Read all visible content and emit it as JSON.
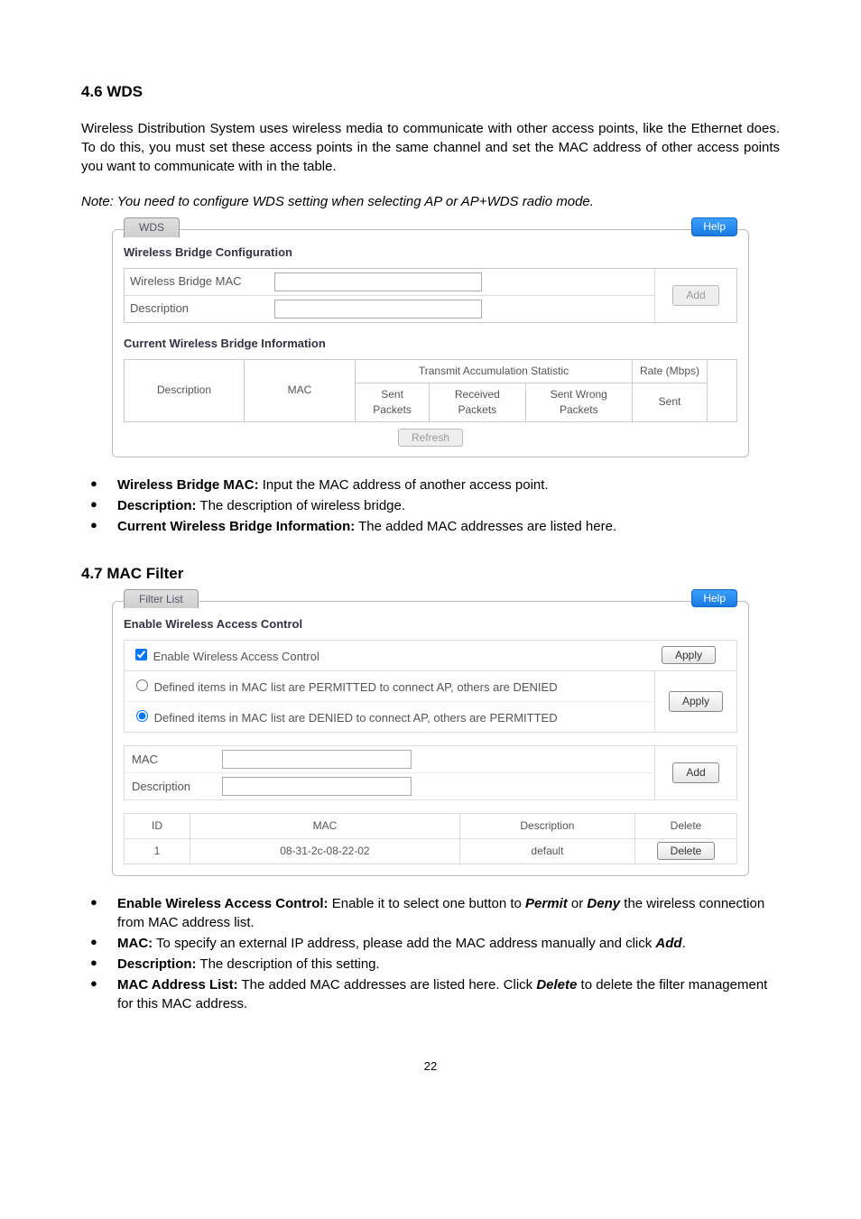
{
  "sec46": {
    "heading": "4.6 WDS",
    "para": "Wireless Distribution System uses wireless media to communicate with other access points, like the Ethernet does. To do this, you must set these access points in the same channel and set the MAC address of other access points you want to communicate with in the table.",
    "note": "Note: You need to configure WDS setting when selecting AP or AP+WDS radio mode."
  },
  "wds_panel": {
    "tab": "WDS",
    "help": "Help",
    "title1": "Wireless Bridge Configuration",
    "row_mac": "Wireless Bridge MAC",
    "row_desc": "Description",
    "add_btn": "Add",
    "title2": "Current Wireless Bridge Information",
    "col_desc": "Description",
    "col_mac": "MAC",
    "col_stat": "Transmit Accumulation Statistic",
    "col_rate": "Rate (Mbps)",
    "col_sent_pkts": "Sent Packets",
    "col_recv_pkts": "Received Packets",
    "col_sent_wrong": "Sent Wrong Packets",
    "col_sent": "Sent",
    "refresh": "Refresh"
  },
  "defs46": [
    {
      "term": "Wireless Bridge MAC:",
      "text": " Input the MAC address of another access point."
    },
    {
      "term": "Description:",
      "text": " The description of wireless bridge."
    },
    {
      "term": "Current Wireless Bridge Information:",
      "text": " The added MAC addresses are listed here."
    }
  ],
  "sec47": {
    "heading": "4.7 MAC Filter"
  },
  "filter_panel": {
    "tab": "Filter List",
    "help": "Help",
    "title": "Enable Wireless Access Control",
    "enable_label": "Enable Wireless Access Control",
    "apply": "Apply",
    "opt_permit": "Defined items in MAC list are PERMITTED to connect AP, others are DENIED",
    "opt_deny": "Defined items in MAC list are DENIED to connect AP, others are PERMITTED",
    "mac_label": "MAC",
    "desc_label": "Description",
    "add_btn": "Add",
    "th_id": "ID",
    "th_mac": "MAC",
    "th_desc": "Description",
    "th_del": "Delete",
    "rows": [
      {
        "id": "1",
        "mac": "08-31-2c-08-22-02",
        "desc": "default",
        "del": "Delete"
      }
    ]
  },
  "defs47": [
    {
      "term": "Enable Wireless Access Control:",
      "text": " Enable it to select one button to ",
      "em1": "Permit",
      "text2": " or ",
      "em2": "Deny",
      "text3": " the wireless connection from MAC address list."
    },
    {
      "term": "MAC:",
      "text": " To specify an external IP address, please add the MAC address manually and click ",
      "em1": "Add",
      "text2": "."
    },
    {
      "term": "Description:",
      "text": " The description of this setting."
    },
    {
      "term": "MAC Address List:",
      "text": "  The added MAC addresses are listed here. Click ",
      "em1": "Delete",
      "text2": " to delete the filter management for this MAC address."
    }
  ],
  "page_number": "22"
}
